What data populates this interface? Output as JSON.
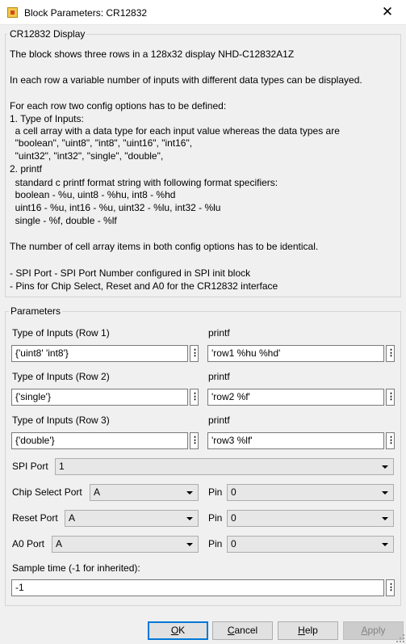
{
  "window": {
    "title": "Block Parameters: CR12832",
    "close_glyph": "✕"
  },
  "description": {
    "group_label": "CR12832 Display",
    "lines": [
      "The block shows three rows in a 128x32 display NHD-C12832A1Z",
      "",
      "In each row a variable number of inputs with different data types can be displayed.",
      "",
      "For each row two config options has to be defined:",
      "1. Type of Inputs:",
      "  a cell array with a data type for each input value whereas the data types are",
      "  \"boolean\", \"uint8\", \"int8\", \"uint16\", \"int16\",",
      "  \"uint32\", \"int32\", \"single\", \"double\",",
      "2. printf",
      "  standard c printf format string with following format specifiers:",
      "  boolean - %u, uint8 - %hu, int8 - %hd",
      "  uint16 - %u, int16 - %u, uint32 - %lu, int32 - %lu",
      "  single - %f, double - %lf",
      "",
      "The number of cell array items in both config options has to be identical.",
      "",
      "- SPI Port - SPI Port Number configured in SPI init block",
      "- Pins for Chip Select, Reset and A0 for the CR12832 interface"
    ]
  },
  "parameters": {
    "group_label": "Parameters",
    "rows": [
      {
        "type_label": "Type of Inputs (Row 1)",
        "type_value": "{'uint8' 'int8'}",
        "printf_label": "printf",
        "printf_value": "'row1 %hu %hd'"
      },
      {
        "type_label": "Type of Inputs (Row 2)",
        "type_value": "{'single'}",
        "printf_label": "printf",
        "printf_value": "'row2 %f'"
      },
      {
        "type_label": "Type of Inputs (Row 3)",
        "type_value": "{'double'}",
        "printf_label": "printf",
        "printf_value": "'row3 %lf'"
      }
    ],
    "spi_port": {
      "label": "SPI Port",
      "value": "1"
    },
    "chip_select": {
      "label": "Chip Select Port",
      "value": "A",
      "pin_label": "Pin",
      "pin_value": "0"
    },
    "reset": {
      "label": "Reset Port",
      "value": "A",
      "pin_label": "Pin",
      "pin_value": "0"
    },
    "a0": {
      "label": "A0 Port",
      "value": "A",
      "pin_label": "Pin",
      "pin_value": "0"
    },
    "sample_time": {
      "label": "Sample time (-1 for inherited):",
      "value": "-1"
    }
  },
  "buttons": {
    "ok": {
      "mnemonic": "O",
      "rest": "K"
    },
    "cancel": {
      "mnemonic": "C",
      "rest": "ancel"
    },
    "help": {
      "mnemonic": "H",
      "rest": "elp"
    },
    "apply": {
      "mnemonic": "A",
      "rest": "pply"
    }
  },
  "icons": {
    "more_options": "⋮",
    "dropdown": "chevron-down-icon"
  },
  "colors": {
    "default_button_border": "#0078d7",
    "background": "#f0f0f0"
  }
}
